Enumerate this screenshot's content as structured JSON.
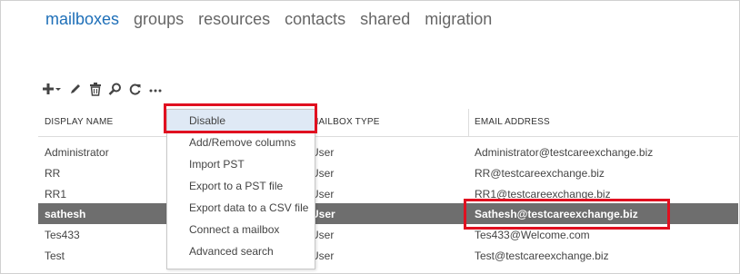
{
  "tabs": [
    {
      "label": "mailboxes",
      "active": true
    },
    {
      "label": "groups"
    },
    {
      "label": "resources"
    },
    {
      "label": "contacts"
    },
    {
      "label": "shared"
    },
    {
      "label": "migration"
    }
  ],
  "toolbar": {
    "icons": [
      "add-icon",
      "dropdown-arrow-icon",
      "edit-icon",
      "delete-icon",
      "search-icon",
      "refresh-icon",
      "more-icon"
    ]
  },
  "columns": {
    "display_name": "DISPLAY NAME",
    "mailbox_type": "MAILBOX TYPE",
    "email_address": "EMAIL ADDRESS"
  },
  "rows": [
    {
      "name": "Administrator",
      "type": "User",
      "email": "Administrator@testcareexchange.biz"
    },
    {
      "name": "RR",
      "type": "User",
      "email": "RR@testcareexchange.biz"
    },
    {
      "name": "RR1",
      "type": "User",
      "email": "RR1@testcareexchange.biz"
    },
    {
      "name": "sathesh",
      "type": "User",
      "email": "Sathesh@testcareexchange.biz",
      "selected": true
    },
    {
      "name": "Tes433",
      "type": "User",
      "email": "Tes433@Welcome.com"
    },
    {
      "name": "Test",
      "type": "User",
      "email": "Test@testcareexchange.biz"
    }
  ],
  "context_menu": {
    "items": [
      "Disable",
      "Add/Remove columns",
      "Import PST",
      "Export to a PST file",
      "Export data to a CSV file",
      "Connect a mailbox",
      "Advanced search"
    ],
    "highlighted": "Disable"
  },
  "colors": {
    "accent": "#1e6fb8",
    "selected_row": "#6e6e6e",
    "menu_highlight": "#dfe9f5",
    "annotation_red": "#e01020"
  }
}
